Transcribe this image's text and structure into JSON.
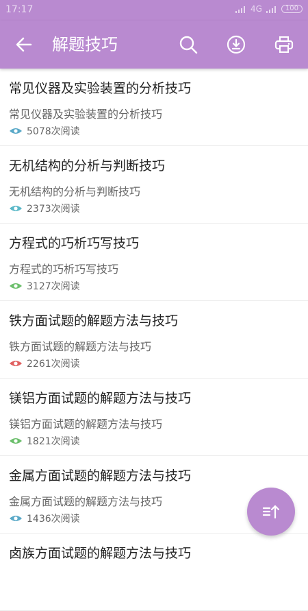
{
  "status_bar": {
    "time": "17:17",
    "network": "4G",
    "battery": "100"
  },
  "app_bar": {
    "title": "解题技巧"
  },
  "articles": [
    {
      "title": "常见仪器及实验装置的分析技巧",
      "summary": "常见仪器及实验装置的分析技巧",
      "views": "5078次阅读",
      "eye_color": "#5aa9c8"
    },
    {
      "title": "无机结构的分析与判断技巧",
      "summary": "无机结构的分析与判断技巧",
      "views": "2373次阅读",
      "eye_color": "#5ab8c8"
    },
    {
      "title": "方程式的巧析巧写技巧",
      "summary": "方程式的巧析巧写技巧",
      "views": "3127次阅读",
      "eye_color": "#6cbf6c"
    },
    {
      "title": "铁方面试题的解题方法与技巧",
      "summary": "铁方面试题的解题方法与技巧",
      "views": "2261次阅读",
      "eye_color": "#e06060"
    },
    {
      "title": "镁铝方面试题的解题方法与技巧",
      "summary": "镁铝方面试题的解题方法与技巧",
      "views": "1821次阅读",
      "eye_color": "#6cbf6c"
    },
    {
      "title": "金属方面试题的解题方法与技巧",
      "summary": "金属方面试题的解题方法与技巧",
      "views": "1436次阅读",
      "eye_color": "#5aa9c8"
    },
    {
      "title": "卤族方面试题的解题方法与技巧",
      "summary": "",
      "views": "",
      "eye_color": "#5aa9c8"
    }
  ],
  "colors": {
    "primary": "#b98ad0"
  }
}
